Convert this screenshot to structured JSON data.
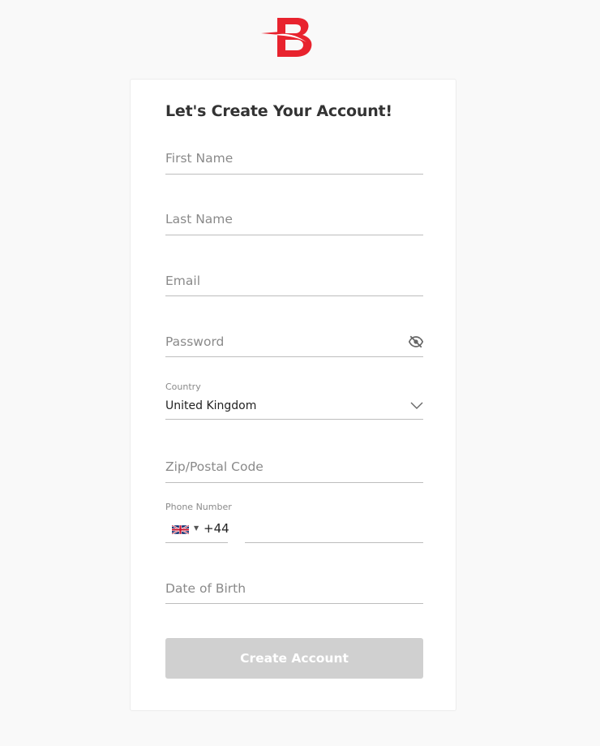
{
  "brand": {
    "logo_letter": "B",
    "color": "#e8232e"
  },
  "form": {
    "title": "Let's Create Your Account!",
    "first_name": {
      "placeholder": "First Name"
    },
    "last_name": {
      "placeholder": "Last Name"
    },
    "email": {
      "placeholder": "Email"
    },
    "password": {
      "placeholder": "Password",
      "icon": "eye-off-icon"
    },
    "country": {
      "label": "Country",
      "value": "United Kingdom",
      "icon": "chevron-down-icon"
    },
    "zip": {
      "placeholder": "Zip/Postal Code"
    },
    "phone": {
      "label": "Phone Number",
      "flag": "uk-flag-icon",
      "dial_code": "+44",
      "value": ""
    },
    "dob": {
      "placeholder": "Date of Birth"
    },
    "submit_label": "Create Account",
    "submit_color": "#d0d0d0"
  }
}
